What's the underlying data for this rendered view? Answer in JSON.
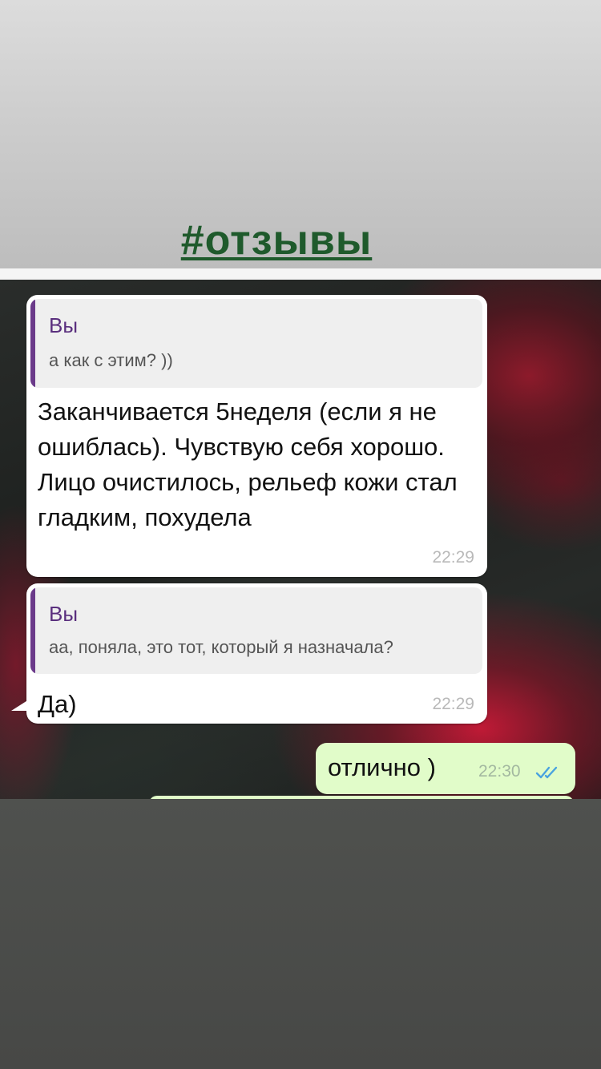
{
  "header": {
    "hashtag": "#отзывы"
  },
  "messages": [
    {
      "quote_author": "Вы",
      "quote_text": "а как с этим? ))",
      "text": "Заканчивается 5неделя (если я не ошиблась). Чувствую себя хорошо. Лицо очистилось, рельеф кожи стал гладким, похудела",
      "time": "22:29"
    },
    {
      "quote_author": "Вы",
      "quote_text": "аа, поняла, это тот, который я назначала?",
      "text": "Да)",
      "time": "22:29"
    },
    {
      "text": "отлично )",
      "time": "22:30",
      "status_icon": "double-check-icon"
    }
  ],
  "colors": {
    "hashtag": "#1f5a2c",
    "quote_accent": "#6b3a8a",
    "outgoing_bubble": "#e1fcc9",
    "read_checks": "#4aa3df"
  }
}
